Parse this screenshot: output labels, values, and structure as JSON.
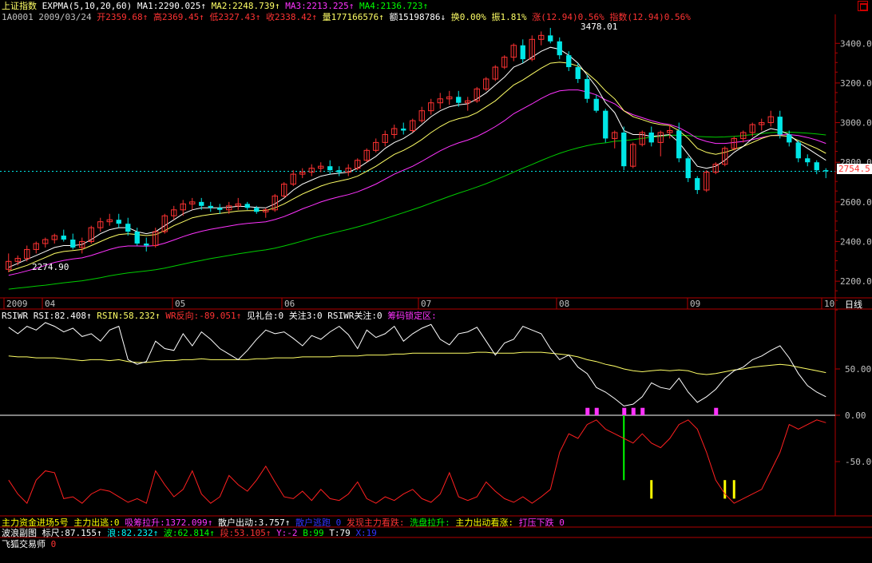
{
  "colors": {
    "background": "#000000",
    "up_candle": "#ff3232",
    "down_candle": "#00e6e6",
    "axis_red": "#b00000",
    "expma1": "#ffffff",
    "expma2": "#ffff66",
    "expma3": "#ff33ff",
    "expma4": "#00cc00"
  },
  "header": {
    "index_name": "上证指数",
    "indicator": "EXPMA(5,10,20,60)",
    "ma1": "MA1:2290.025↑",
    "ma2": "MA2:2248.739↑",
    "ma3": "MA3:2213.225↑",
    "ma4": "MA4:2136.723↑"
  },
  "quote": {
    "code_date": "1A0001 2009/03/24",
    "open": "开2359.68↑",
    "high": "高2369.45↑",
    "low": "低2327.43↑",
    "close": "收2338.42↑",
    "volume": "量177166576↑",
    "amount": "额15198786↓",
    "turnover": "换0.00%",
    "amplitude": "振1.81%",
    "change": "涨(12.94)0.56%",
    "index_change": "指数(12.94)0.56%"
  },
  "price_panel": {
    "high_label": "3478.01",
    "low_label": "2274.90",
    "current_price": "2754.5",
    "y_ticks": [
      "3400.00",
      "3200.00",
      "3000.00",
      "2800.00",
      "2600.00",
      "2400.00",
      "2200.00"
    ],
    "y_tick_values": [
      3400,
      3200,
      3000,
      2800,
      2600,
      2400,
      2200
    ],
    "y_range": [
      2120,
      3530
    ]
  },
  "time_axis": {
    "labels": [
      "2009",
      "04",
      "05",
      "06",
      "07",
      "08",
      "09",
      "10"
    ],
    "period_button": "日线"
  },
  "rsi_panel": {
    "title": "RSIWR",
    "rsi": "RSI:82.408↑",
    "rsin": "RSIN:58.232↑",
    "wr": "WR反向:-89.051↑",
    "jianli": "见礼台:0",
    "guanzhu3": "关注3:0",
    "rsiwr_guanzhu": "RSIWR关注:0",
    "chouma": "筹码锁定区:",
    "y_ticks": [
      "50.00",
      "0.00",
      "-50.00"
    ],
    "y_tick_values": [
      50,
      0,
      -50
    ],
    "y_range": [
      -100,
      100
    ]
  },
  "footer": {
    "row1": [
      {
        "text": "主力资金进场5号",
        "color": "#ffff00"
      },
      {
        "text": "主力出逃:0",
        "color": "#ffff00"
      },
      {
        "text": "吸筹拉升:1372.099↑",
        "color": "#ff33ff"
      },
      {
        "text": "散户出动:3.757↑",
        "color": "#ffffff"
      },
      {
        "text": "散户逃跑 0",
        "color": "#3333ff"
      },
      {
        "text": "发现主力看跌:",
        "color": "#ff3333"
      },
      {
        "text": "洗盘拉升:",
        "color": "#00ff00"
      },
      {
        "text": "主力出动看涨:",
        "color": "#ffff00"
      },
      {
        "text": "打压下跌 0",
        "color": "#ff33ff"
      }
    ],
    "row2": [
      {
        "text": "波浪副图 标尺:87.155↑",
        "color": "#ffffff"
      },
      {
        "text": "浪:82.232↑",
        "color": "#00ffff"
      },
      {
        "text": "波:62.814↑",
        "color": "#00ff00"
      },
      {
        "text": "段:53.105↑",
        "color": "#ff3333"
      },
      {
        "text": "Y:-2",
        "color": "#ff33ff"
      },
      {
        "text": "B:99",
        "color": "#00ff00"
      },
      {
        "text": "T:79",
        "color": "#ffffff"
      },
      {
        "text": "X:19",
        "color": "#3333ff"
      }
    ],
    "row3": [
      {
        "text": "飞狐交易师",
        "color": "#ffffff"
      },
      {
        "text": "0",
        "color": "#ff3333"
      }
    ]
  },
  "chart_data": {
    "type": "candlestick",
    "ohlc": [
      [
        2260,
        2340,
        2245,
        2300
      ],
      [
        2300,
        2330,
        2280,
        2315
      ],
      [
        2315,
        2380,
        2300,
        2360
      ],
      [
        2360,
        2400,
        2340,
        2390
      ],
      [
        2390,
        2420,
        2370,
        2410
      ],
      [
        2410,
        2440,
        2390,
        2430
      ],
      [
        2430,
        2460,
        2400,
        2410
      ],
      [
        2410,
        2440,
        2360,
        2370
      ],
      [
        2370,
        2420,
        2340,
        2400
      ],
      [
        2400,
        2480,
        2390,
        2470
      ],
      [
        2470,
        2520,
        2450,
        2500
      ],
      [
        2500,
        2540,
        2480,
        2510
      ],
      [
        2510,
        2540,
        2470,
        2490
      ],
      [
        2490,
        2520,
        2430,
        2450
      ],
      [
        2450,
        2470,
        2380,
        2390
      ],
      [
        2390,
        2420,
        2350,
        2380
      ],
      [
        2380,
        2470,
        2370,
        2450
      ],
      [
        2450,
        2540,
        2440,
        2530
      ],
      [
        2530,
        2580,
        2510,
        2560
      ],
      [
        2560,
        2610,
        2530,
        2590
      ],
      [
        2590,
        2620,
        2560,
        2600
      ],
      [
        2600,
        2620,
        2560,
        2580
      ],
      [
        2580,
        2600,
        2550,
        2570
      ],
      [
        2570,
        2590,
        2540,
        2560
      ],
      [
        2560,
        2600,
        2540,
        2580
      ],
      [
        2580,
        2620,
        2560,
        2590
      ],
      [
        2590,
        2600,
        2560,
        2570
      ],
      [
        2570,
        2580,
        2540,
        2550
      ],
      [
        2550,
        2570,
        2520,
        2560
      ],
      [
        2560,
        2640,
        2550,
        2630
      ],
      [
        2630,
        2700,
        2620,
        2690
      ],
      [
        2690,
        2760,
        2680,
        2740
      ],
      [
        2740,
        2770,
        2720,
        2750
      ],
      [
        2750,
        2790,
        2730,
        2770
      ],
      [
        2770,
        2800,
        2750,
        2780
      ],
      [
        2780,
        2810,
        2740,
        2760
      ],
      [
        2760,
        2780,
        2730,
        2750
      ],
      [
        2750,
        2790,
        2730,
        2770
      ],
      [
        2770,
        2820,
        2760,
        2810
      ],
      [
        2810,
        2870,
        2800,
        2860
      ],
      [
        2860,
        2920,
        2850,
        2900
      ],
      [
        2900,
        2960,
        2880,
        2940
      ],
      [
        2940,
        2990,
        2920,
        2970
      ],
      [
        2970,
        3000,
        2940,
        2960
      ],
      [
        2960,
        3020,
        2950,
        3010
      ],
      [
        3010,
        3080,
        3000,
        3060
      ],
      [
        3060,
        3120,
        3040,
        3100
      ],
      [
        3100,
        3150,
        3070,
        3120
      ],
      [
        3120,
        3160,
        3090,
        3130
      ],
      [
        3130,
        3160,
        3080,
        3100
      ],
      [
        3100,
        3130,
        3060,
        3110
      ],
      [
        3110,
        3180,
        3100,
        3170
      ],
      [
        3170,
        3230,
        3160,
        3220
      ],
      [
        3220,
        3290,
        3210,
        3280
      ],
      [
        3280,
        3340,
        3270,
        3330
      ],
      [
        3330,
        3400,
        3310,
        3390
      ],
      [
        3390,
        3420,
        3300,
        3320
      ],
      [
        3320,
        3440,
        3310,
        3420
      ],
      [
        3420,
        3460,
        3390,
        3440
      ],
      [
        3440,
        3478,
        3400,
        3410
      ],
      [
        3410,
        3430,
        3320,
        3340
      ],
      [
        3340,
        3360,
        3260,
        3280
      ],
      [
        3280,
        3300,
        3200,
        3220
      ],
      [
        3220,
        3240,
        3100,
        3120
      ],
      [
        3120,
        3140,
        3050,
        3060
      ],
      [
        3060,
        3070,
        2900,
        2920
      ],
      [
        2920,
        2960,
        2870,
        2950
      ],
      [
        2950,
        2980,
        2760,
        2780
      ],
      [
        2780,
        2900,
        2770,
        2890
      ],
      [
        2890,
        2960,
        2880,
        2950
      ],
      [
        2950,
        2980,
        2880,
        2900
      ],
      [
        2900,
        2960,
        2830,
        2950
      ],
      [
        2950,
        2990,
        2920,
        2960
      ],
      [
        2960,
        3000,
        2800,
        2820
      ],
      [
        2820,
        2830,
        2700,
        2720
      ],
      [
        2720,
        2730,
        2640,
        2660
      ],
      [
        2660,
        2760,
        2650,
        2750
      ],
      [
        2750,
        2800,
        2740,
        2790
      ],
      [
        2790,
        2880,
        2780,
        2870
      ],
      [
        2870,
        2930,
        2860,
        2920
      ],
      [
        2920,
        2960,
        2900,
        2950
      ],
      [
        2950,
        3000,
        2930,
        2990
      ],
      [
        2990,
        3020,
        2960,
        3000
      ],
      [
        3000,
        3060,
        2980,
        3030
      ],
      [
        3030,
        3060,
        2920,
        2940
      ],
      [
        2940,
        2960,
        2880,
        2900
      ],
      [
        2900,
        2910,
        2800,
        2820
      ],
      [
        2820,
        2840,
        2780,
        2800
      ],
      [
        2800,
        2810,
        2740,
        2760
      ],
      [
        2760,
        2770,
        2720,
        2754.5
      ]
    ],
    "expma1": [
      2270,
      2290,
      2310,
      2330,
      2350,
      2370,
      2380,
      2380,
      2385,
      2410,
      2440,
      2460,
      2470,
      2470,
      2450,
      2440,
      2450,
      2480,
      2510,
      2540,
      2560,
      2570,
      2570,
      2570,
      2573,
      2578,
      2576,
      2572,
      2570,
      2590,
      2620,
      2660,
      2690,
      2710,
      2730,
      2740,
      2745,
      2750,
      2770,
      2800,
      2830,
      2870,
      2900,
      2920,
      2950,
      2990,
      3030,
      3060,
      3080,
      3090,
      3095,
      3120,
      3150,
      3190,
      3230,
      3280,
      3300,
      3330,
      3360,
      3380,
      3370,
      3340,
      3300,
      3240,
      3180,
      3100,
      3050,
      2960,
      2940,
      2940,
      2930,
      2935,
      2940,
      2900,
      2840,
      2780,
      2770,
      2780,
      2810,
      2850,
      2880,
      2920,
      2950,
      2970,
      2960,
      2940,
      2900,
      2870,
      2840,
      2810
    ],
    "expma2": [
      2250,
      2265,
      2280,
      2300,
      2320,
      2340,
      2350,
      2355,
      2360,
      2380,
      2400,
      2420,
      2435,
      2440,
      2435,
      2430,
      2435,
      2455,
      2480,
      2500,
      2520,
      2530,
      2537,
      2542,
      2548,
      2554,
      2556,
      2556,
      2557,
      2570,
      2590,
      2615,
      2640,
      2660,
      2680,
      2695,
      2705,
      2715,
      2730,
      2755,
      2780,
      2810,
      2840,
      2860,
      2885,
      2915,
      2950,
      2980,
      3005,
      3020,
      3030,
      3050,
      3080,
      3110,
      3150,
      3190,
      3215,
      3245,
      3275,
      3300,
      3305,
      3300,
      3285,
      3250,
      3210,
      3160,
      3120,
      3060,
      3030,
      3015,
      3000,
      2990,
      2985,
      2960,
      2920,
      2870,
      2850,
      2840,
      2850,
      2865,
      2880,
      2900,
      2920,
      2935,
      2935,
      2930,
      2910,
      2890,
      2870,
      2845
    ],
    "expma3": [
      2230,
      2240,
      2252,
      2265,
      2280,
      2295,
      2305,
      2312,
      2318,
      2330,
      2345,
      2360,
      2372,
      2378,
      2378,
      2377,
      2380,
      2392,
      2408,
      2425,
      2440,
      2452,
      2462,
      2470,
      2478,
      2486,
      2492,
      2496,
      2500,
      2511,
      2526,
      2545,
      2565,
      2582,
      2600,
      2614,
      2626,
      2637,
      2651,
      2670,
      2690,
      2715,
      2740,
      2760,
      2780,
      2805,
      2832,
      2858,
      2880,
      2898,
      2912,
      2930,
      2954,
      2980,
      3010,
      3045,
      3070,
      3095,
      3122,
      3145,
      3160,
      3165,
      3165,
      3155,
      3140,
      3115,
      3095,
      3060,
      3040,
      3025,
      3010,
      2998,
      2990,
      2975,
      2950,
      2920,
      2905,
      2895,
      2895,
      2900,
      2905,
      2915,
      2925,
      2935,
      2938,
      2940,
      2935,
      2925,
      2912,
      2895
    ],
    "expma4": [
      2160,
      2165,
      2170,
      2175,
      2180,
      2186,
      2192,
      2197,
      2202,
      2210,
      2218,
      2227,
      2235,
      2242,
      2247,
      2252,
      2258,
      2266,
      2276,
      2286,
      2296,
      2305,
      2314,
      2322,
      2330,
      2338,
      2345,
      2352,
      2358,
      2367,
      2378,
      2390,
      2403,
      2416,
      2428,
      2440,
      2451,
      2462,
      2474,
      2487,
      2501,
      2516,
      2531,
      2546,
      2561,
      2577,
      2594,
      2611,
      2628,
      2644,
      2659,
      2675,
      2692,
      2711,
      2730,
      2751,
      2770,
      2789,
      2809,
      2828,
      2845,
      2860,
      2873,
      2884,
      2893,
      2898,
      2906,
      2909,
      2914,
      2921,
      2926,
      2931,
      2936,
      2937,
      2935,
      2930,
      2928,
      2927,
      2928,
      2931,
      2935,
      2940,
      2945,
      2950,
      2952,
      2952,
      2950,
      2947,
      2943,
      2938
    ],
    "rsi": [
      95,
      88,
      96,
      92,
      100,
      96,
      90,
      94,
      85,
      88,
      80,
      92,
      96,
      60,
      55,
      58,
      80,
      72,
      70,
      88,
      75,
      90,
      82,
      72,
      66,
      60,
      70,
      82,
      92,
      88,
      90,
      83,
      75,
      86,
      82,
      90,
      96,
      87,
      72,
      92,
      84,
      88,
      96,
      80,
      88,
      94,
      98,
      82,
      76,
      88,
      90,
      95,
      80,
      65,
      78,
      82,
      96,
      92,
      88,
      72,
      60,
      65,
      52,
      45,
      30,
      25,
      18,
      10,
      12,
      20,
      35,
      30,
      28,
      40,
      25,
      14,
      20,
      28,
      40,
      48,
      52,
      60,
      64,
      70,
      75,
      62,
      45,
      32,
      25,
      20
    ],
    "rsin": [
      64,
      63,
      63,
      62,
      62,
      62,
      61,
      60,
      59,
      60,
      60,
      59,
      60,
      58,
      57,
      57,
      58,
      59,
      59,
      60,
      60,
      61,
      60,
      60,
      60,
      60,
      60,
      61,
      61,
      62,
      62,
      62,
      63,
      63,
      63,
      63,
      64,
      64,
      64,
      65,
      65,
      65,
      66,
      66,
      67,
      67,
      67,
      67,
      67,
      67,
      67,
      68,
      68,
      67,
      67,
      67,
      68,
      68,
      68,
      67,
      66,
      65,
      63,
      60,
      58,
      55,
      53,
      50,
      48,
      47,
      48,
      49,
      48,
      49,
      48,
      45,
      44,
      45,
      47,
      49,
      50,
      52,
      53,
      54,
      55,
      54,
      52,
      50,
      48,
      46
    ],
    "wr": [
      -70,
      -85,
      -95,
      -70,
      -60,
      -62,
      -90,
      -88,
      -95,
      -85,
      -80,
      -82,
      -88,
      -94,
      -90,
      -95,
      -60,
      -75,
      -88,
      -80,
      -60,
      -85,
      -95,
      -88,
      -65,
      -75,
      -82,
      -70,
      -55,
      -72,
      -88,
      -90,
      -82,
      -92,
      -80,
      -90,
      -92,
      -85,
      -72,
      -90,
      -95,
      -88,
      -92,
      -85,
      -80,
      -90,
      -94,
      -85,
      -62,
      -88,
      -92,
      -88,
      -72,
      -82,
      -90,
      -94,
      -88,
      -95,
      -88,
      -80,
      -40,
      -20,
      -25,
      -10,
      -5,
      -15,
      -20,
      -25,
      -30,
      -20,
      -30,
      -35,
      -25,
      -10,
      -5,
      -15,
      -40,
      -70,
      -85,
      -95,
      -90,
      -85,
      -80,
      -60,
      -40,
      -10,
      -15,
      -10,
      -5,
      -8
    ],
    "magenta_bars": [
      63,
      64,
      67,
      68,
      69,
      77
    ],
    "green_bar": 67,
    "yellow_bars": [
      70,
      78,
      79
    ]
  }
}
